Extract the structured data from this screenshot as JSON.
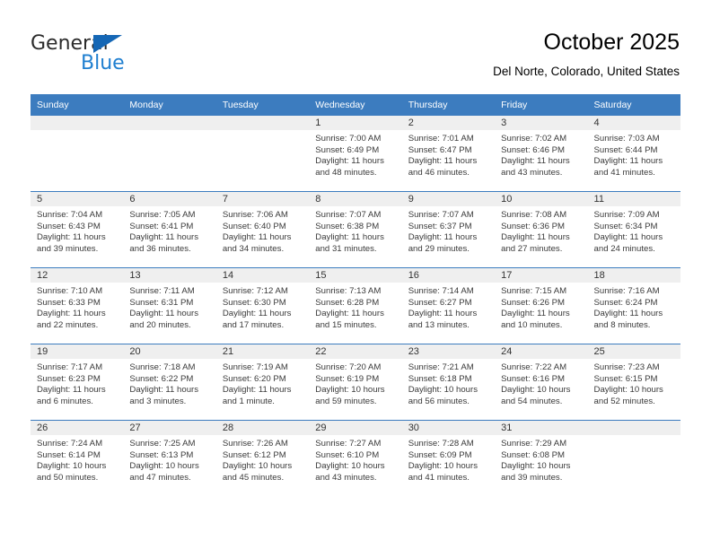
{
  "brand": {
    "name_part1": "General",
    "name_part2": "Blue",
    "triangle_color": "#1567b5",
    "blue_text_color": "#1f7fd0"
  },
  "header": {
    "title": "October 2025",
    "subtitle": "Del Norte, Colorado, United States"
  },
  "theme": {
    "header_bg": "#3c7cbf",
    "header_text": "#ffffff",
    "daynum_band_bg": "#efefef",
    "cell_bg": "#ffffff",
    "row_divider": "#3c7cbf"
  },
  "calendar": {
    "weekday_headers": [
      "Sunday",
      "Monday",
      "Tuesday",
      "Wednesday",
      "Thursday",
      "Friday",
      "Saturday"
    ],
    "weeks": [
      [
        {
          "blank": true
        },
        {
          "blank": true
        },
        {
          "blank": true
        },
        {
          "day": "1",
          "sunrise": "Sunrise: 7:00 AM",
          "sunset": "Sunset: 6:49 PM",
          "daylight_line1": "Daylight: 11 hours",
          "daylight_line2": "and 48 minutes."
        },
        {
          "day": "2",
          "sunrise": "Sunrise: 7:01 AM",
          "sunset": "Sunset: 6:47 PM",
          "daylight_line1": "Daylight: 11 hours",
          "daylight_line2": "and 46 minutes."
        },
        {
          "day": "3",
          "sunrise": "Sunrise: 7:02 AM",
          "sunset": "Sunset: 6:46 PM",
          "daylight_line1": "Daylight: 11 hours",
          "daylight_line2": "and 43 minutes."
        },
        {
          "day": "4",
          "sunrise": "Sunrise: 7:03 AM",
          "sunset": "Sunset: 6:44 PM",
          "daylight_line1": "Daylight: 11 hours",
          "daylight_line2": "and 41 minutes."
        }
      ],
      [
        {
          "day": "5",
          "sunrise": "Sunrise: 7:04 AM",
          "sunset": "Sunset: 6:43 PM",
          "daylight_line1": "Daylight: 11 hours",
          "daylight_line2": "and 39 minutes."
        },
        {
          "day": "6",
          "sunrise": "Sunrise: 7:05 AM",
          "sunset": "Sunset: 6:41 PM",
          "daylight_line1": "Daylight: 11 hours",
          "daylight_line2": "and 36 minutes."
        },
        {
          "day": "7",
          "sunrise": "Sunrise: 7:06 AM",
          "sunset": "Sunset: 6:40 PM",
          "daylight_line1": "Daylight: 11 hours",
          "daylight_line2": "and 34 minutes."
        },
        {
          "day": "8",
          "sunrise": "Sunrise: 7:07 AM",
          "sunset": "Sunset: 6:38 PM",
          "daylight_line1": "Daylight: 11 hours",
          "daylight_line2": "and 31 minutes."
        },
        {
          "day": "9",
          "sunrise": "Sunrise: 7:07 AM",
          "sunset": "Sunset: 6:37 PM",
          "daylight_line1": "Daylight: 11 hours",
          "daylight_line2": "and 29 minutes."
        },
        {
          "day": "10",
          "sunrise": "Sunrise: 7:08 AM",
          "sunset": "Sunset: 6:36 PM",
          "daylight_line1": "Daylight: 11 hours",
          "daylight_line2": "and 27 minutes."
        },
        {
          "day": "11",
          "sunrise": "Sunrise: 7:09 AM",
          "sunset": "Sunset: 6:34 PM",
          "daylight_line1": "Daylight: 11 hours",
          "daylight_line2": "and 24 minutes."
        }
      ],
      [
        {
          "day": "12",
          "sunrise": "Sunrise: 7:10 AM",
          "sunset": "Sunset: 6:33 PM",
          "daylight_line1": "Daylight: 11 hours",
          "daylight_line2": "and 22 minutes."
        },
        {
          "day": "13",
          "sunrise": "Sunrise: 7:11 AM",
          "sunset": "Sunset: 6:31 PM",
          "daylight_line1": "Daylight: 11 hours",
          "daylight_line2": "and 20 minutes."
        },
        {
          "day": "14",
          "sunrise": "Sunrise: 7:12 AM",
          "sunset": "Sunset: 6:30 PM",
          "daylight_line1": "Daylight: 11 hours",
          "daylight_line2": "and 17 minutes."
        },
        {
          "day": "15",
          "sunrise": "Sunrise: 7:13 AM",
          "sunset": "Sunset: 6:28 PM",
          "daylight_line1": "Daylight: 11 hours",
          "daylight_line2": "and 15 minutes."
        },
        {
          "day": "16",
          "sunrise": "Sunrise: 7:14 AM",
          "sunset": "Sunset: 6:27 PM",
          "daylight_line1": "Daylight: 11 hours",
          "daylight_line2": "and 13 minutes."
        },
        {
          "day": "17",
          "sunrise": "Sunrise: 7:15 AM",
          "sunset": "Sunset: 6:26 PM",
          "daylight_line1": "Daylight: 11 hours",
          "daylight_line2": "and 10 minutes."
        },
        {
          "day": "18",
          "sunrise": "Sunrise: 7:16 AM",
          "sunset": "Sunset: 6:24 PM",
          "daylight_line1": "Daylight: 11 hours",
          "daylight_line2": "and 8 minutes."
        }
      ],
      [
        {
          "day": "19",
          "sunrise": "Sunrise: 7:17 AM",
          "sunset": "Sunset: 6:23 PM",
          "daylight_line1": "Daylight: 11 hours",
          "daylight_line2": "and 6 minutes."
        },
        {
          "day": "20",
          "sunrise": "Sunrise: 7:18 AM",
          "sunset": "Sunset: 6:22 PM",
          "daylight_line1": "Daylight: 11 hours",
          "daylight_line2": "and 3 minutes."
        },
        {
          "day": "21",
          "sunrise": "Sunrise: 7:19 AM",
          "sunset": "Sunset: 6:20 PM",
          "daylight_line1": "Daylight: 11 hours",
          "daylight_line2": "and 1 minute."
        },
        {
          "day": "22",
          "sunrise": "Sunrise: 7:20 AM",
          "sunset": "Sunset: 6:19 PM",
          "daylight_line1": "Daylight: 10 hours",
          "daylight_line2": "and 59 minutes."
        },
        {
          "day": "23",
          "sunrise": "Sunrise: 7:21 AM",
          "sunset": "Sunset: 6:18 PM",
          "daylight_line1": "Daylight: 10 hours",
          "daylight_line2": "and 56 minutes."
        },
        {
          "day": "24",
          "sunrise": "Sunrise: 7:22 AM",
          "sunset": "Sunset: 6:16 PM",
          "daylight_line1": "Daylight: 10 hours",
          "daylight_line2": "and 54 minutes."
        },
        {
          "day": "25",
          "sunrise": "Sunrise: 7:23 AM",
          "sunset": "Sunset: 6:15 PM",
          "daylight_line1": "Daylight: 10 hours",
          "daylight_line2": "and 52 minutes."
        }
      ],
      [
        {
          "day": "26",
          "sunrise": "Sunrise: 7:24 AM",
          "sunset": "Sunset: 6:14 PM",
          "daylight_line1": "Daylight: 10 hours",
          "daylight_line2": "and 50 minutes."
        },
        {
          "day": "27",
          "sunrise": "Sunrise: 7:25 AM",
          "sunset": "Sunset: 6:13 PM",
          "daylight_line1": "Daylight: 10 hours",
          "daylight_line2": "and 47 minutes."
        },
        {
          "day": "28",
          "sunrise": "Sunrise: 7:26 AM",
          "sunset": "Sunset: 6:12 PM",
          "daylight_line1": "Daylight: 10 hours",
          "daylight_line2": "and 45 minutes."
        },
        {
          "day": "29",
          "sunrise": "Sunrise: 7:27 AM",
          "sunset": "Sunset: 6:10 PM",
          "daylight_line1": "Daylight: 10 hours",
          "daylight_line2": "and 43 minutes."
        },
        {
          "day": "30",
          "sunrise": "Sunrise: 7:28 AM",
          "sunset": "Sunset: 6:09 PM",
          "daylight_line1": "Daylight: 10 hours",
          "daylight_line2": "and 41 minutes."
        },
        {
          "day": "31",
          "sunrise": "Sunrise: 7:29 AM",
          "sunset": "Sunset: 6:08 PM",
          "daylight_line1": "Daylight: 10 hours",
          "daylight_line2": "and 39 minutes."
        },
        {
          "blank": true
        }
      ]
    ]
  }
}
